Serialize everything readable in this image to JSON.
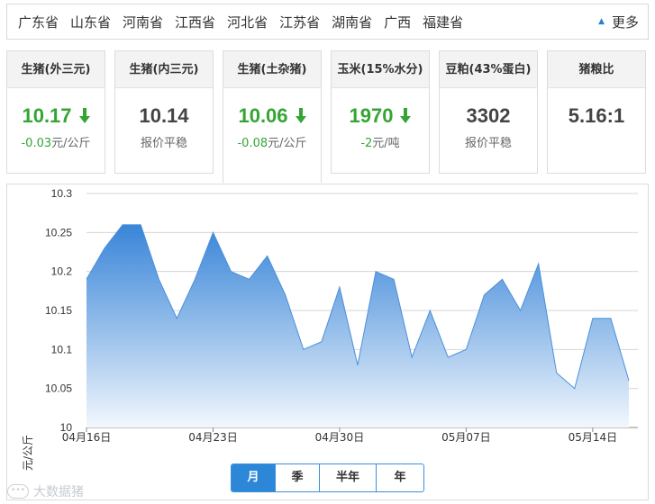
{
  "provinces": [
    "广东省",
    "山东省",
    "河南省",
    "江西省",
    "河北省",
    "江苏省",
    "湖南省",
    "广西",
    "福建省"
  ],
  "more_label": "更多",
  "cards": [
    {
      "title": "生猪(外三元)",
      "value": "10.17",
      "trend": "down",
      "change_num": "-0.03",
      "change_unit": "元/公斤",
      "active": false
    },
    {
      "title": "生猪(内三元)",
      "value": "10.14",
      "trend": "flat",
      "change_num": "",
      "change_unit": "报价平稳",
      "active": false
    },
    {
      "title": "生猪(土杂猪)",
      "value": "10.06",
      "trend": "down",
      "change_num": "-0.08",
      "change_unit": "元/公斤",
      "active": true
    },
    {
      "title": "玉米(15%水分)",
      "value": "1970",
      "trend": "down",
      "change_num": "-2",
      "change_unit": "元/吨",
      "active": false
    },
    {
      "title": "豆粕(43%蛋白)",
      "value": "3302",
      "trend": "flat",
      "change_num": "",
      "change_unit": "报价平稳",
      "active": false
    },
    {
      "title": "猪粮比",
      "value": "5.16:1",
      "trend": "flat",
      "change_num": "",
      "change_unit": "",
      "active": false
    }
  ],
  "colors": {
    "down": "#34a534",
    "accent": "#2d87d8",
    "area_top": "#2f7fd6",
    "area_bottom": "#f2f7fd"
  },
  "chart_data": {
    "type": "area",
    "ylabel": "元/公斤",
    "xlabel": "",
    "ylim": [
      10.0,
      10.3
    ],
    "yticks": [
      "10",
      "10.05",
      "10.1",
      "10.15",
      "10.2",
      "10.25",
      "10.3"
    ],
    "xticks": [
      "04月16日",
      "04月23日",
      "04月30日",
      "05月07日",
      "05月14日"
    ],
    "grid": true,
    "series": [
      {
        "values": [
          10.19,
          10.23,
          10.26,
          10.26,
          10.19,
          10.14,
          10.19,
          10.25,
          10.2,
          10.19,
          10.22,
          10.17,
          10.1,
          10.11,
          10.18,
          10.08,
          10.2,
          10.19,
          10.09,
          10.15,
          10.09,
          10.1,
          10.17,
          10.19,
          10.15,
          10.21,
          10.07,
          10.05,
          10.14,
          10.14,
          10.06
        ]
      }
    ]
  },
  "periods": [
    "月",
    "季",
    "半年",
    "年"
  ],
  "active_period": "月",
  "watermark": "大数据猪"
}
